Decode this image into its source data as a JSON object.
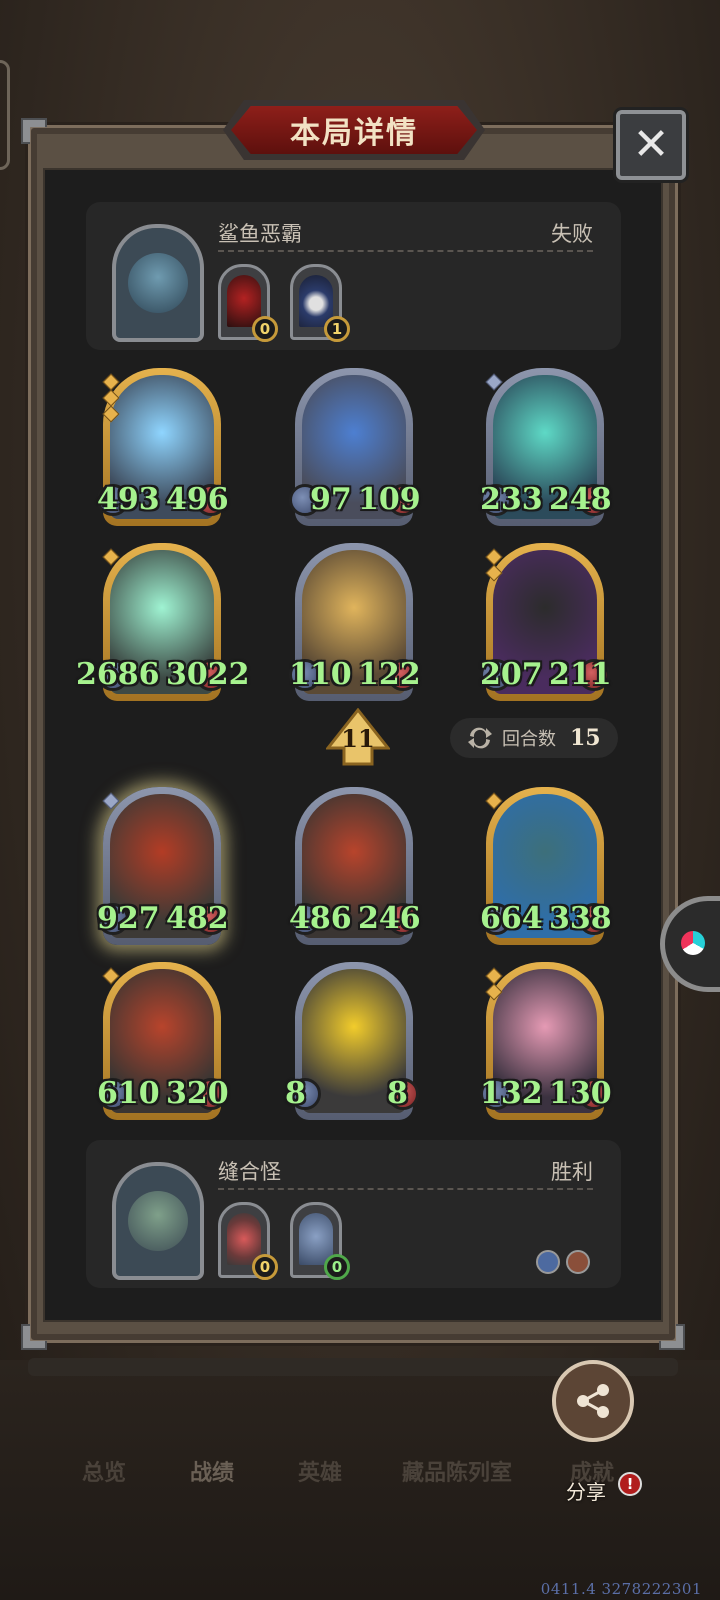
{
  "window": {
    "title": "本局详情"
  },
  "opponent": {
    "name": "鲨鱼恶霸",
    "result": "失败",
    "items": [
      {
        "icon": "red-mask-icon",
        "count": "0",
        "badge_color": "gold"
      },
      {
        "icon": "wizard-icon",
        "count": "1",
        "badge_color": "gold"
      }
    ]
  },
  "opponent_board": [
    {
      "atk": "493",
      "hp": "496",
      "frame": "gold",
      "gems": 3,
      "art": [
        "#3e4b5c",
        "#8fd5ff"
      ]
    },
    {
      "atk": "97",
      "hp": "109",
      "frame": "silver",
      "gems": 0,
      "art": [
        "#4a4d5c",
        "#4d7fd1"
      ]
    },
    {
      "atk": "233",
      "hp": "248",
      "frame": "silver",
      "gems": 1,
      "art": [
        "#2c4b5b",
        "#5ed9c6"
      ]
    },
    {
      "atk": "2686",
      "hp": "3022",
      "frame": "gold",
      "gems": 1,
      "art": [
        "#3d4a45",
        "#9ff3d2"
      ]
    },
    {
      "atk": "110",
      "hp": "122",
      "frame": "silver",
      "gems": 0,
      "art": [
        "#5b4a35",
        "#e0b45c"
      ]
    },
    {
      "atk": "207",
      "hp": "211",
      "frame": "gold",
      "gems": 2,
      "art": [
        "#4a2c5e",
        "#2c2c2c"
      ]
    }
  ],
  "turn": {
    "number": "11"
  },
  "rounds": {
    "label": "回合数",
    "value": "15"
  },
  "player_board": [
    {
      "atk": "927",
      "hp": "482",
      "frame": "silver",
      "gems": 1,
      "glow": true,
      "art": [
        "#3d3a36",
        "#b33c25"
      ]
    },
    {
      "atk": "486",
      "hp": "246",
      "frame": "silver",
      "gems": 0,
      "glow": false,
      "art": [
        "#3a3532",
        "#b8442c"
      ]
    },
    {
      "atk": "664",
      "hp": "338",
      "frame": "gold",
      "gems": 1,
      "glow": false,
      "art": [
        "#2f6ea8",
        "#3d6f7a"
      ]
    },
    {
      "atk": "610",
      "hp": "320",
      "frame": "gold",
      "gems": 1,
      "glow": false,
      "art": [
        "#3a3532",
        "#b8442c"
      ]
    },
    {
      "atk": "8",
      "hp": "8",
      "frame": "silver",
      "gems": 0,
      "glow": false,
      "art": [
        "#3b3a3a",
        "#f2cc2b"
      ]
    },
    {
      "atk": "132",
      "hp": "130",
      "frame": "gold",
      "gems": 2,
      "glow": false,
      "art": [
        "#3b3240",
        "#e59ab4"
      ]
    }
  ],
  "player": {
    "name": "缝合怪",
    "result": "胜利",
    "items": [
      {
        "icon": "meat-icon",
        "count": "0",
        "badge_color": "gold"
      },
      {
        "icon": "brawler-icon",
        "count": "0",
        "badge_color": "green"
      }
    ]
  },
  "share": {
    "label": "分享",
    "alert": "!"
  },
  "nav": {
    "items": [
      {
        "label": "总览",
        "active": false
      },
      {
        "label": "战绩",
        "active": true
      },
      {
        "label": "英雄",
        "active": false
      },
      {
        "label": "藏品陈列室",
        "active": false
      },
      {
        "label": "成就",
        "active": false
      }
    ]
  },
  "build_id": "0411.4 3278222301",
  "colors": {
    "stat_green": "#a6f28e",
    "title_red": "#8e1f1a",
    "gold_frame": "#e5b24d",
    "silver_frame": "#8d96ad"
  }
}
